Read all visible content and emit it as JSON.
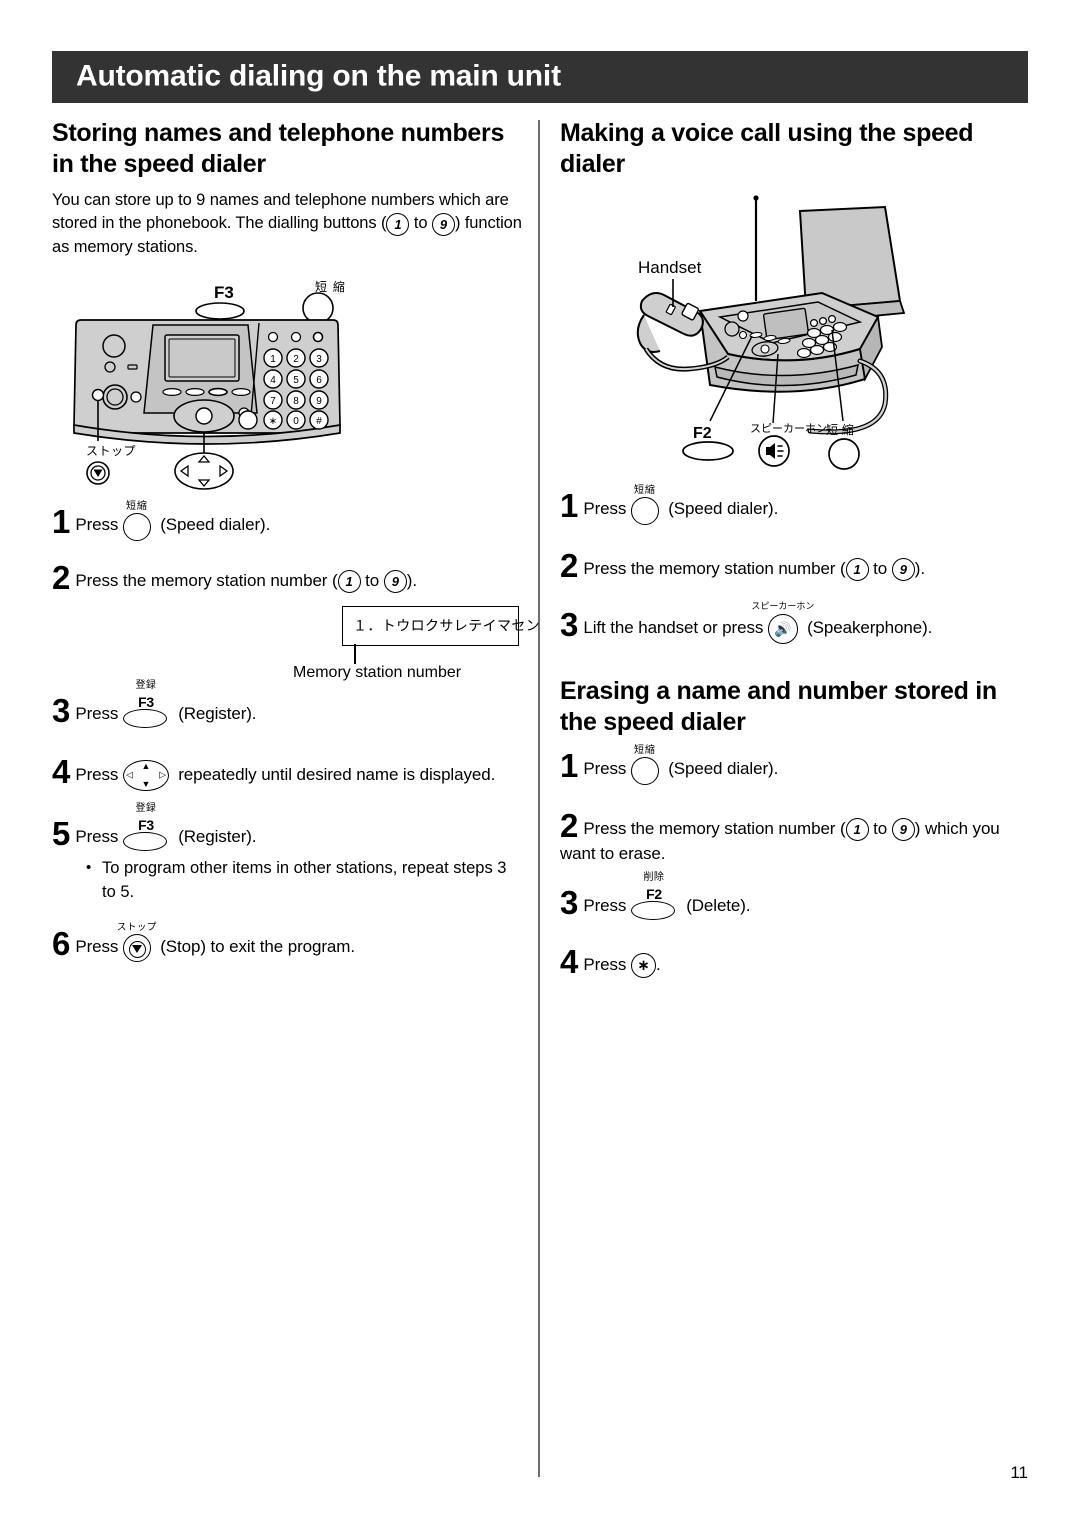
{
  "header": {
    "title": "Automatic dialing on the main unit"
  },
  "left": {
    "section_title": "Storing names and telephone numbers in the speed dialer",
    "intro_part1": "You can store up to 9 names and telephone numbers which are stored in the phonebook. The dialling buttons (",
    "intro_digit_from": "1",
    "intro_mid": " to ",
    "intro_digit_to": "9",
    "intro_part2": ") function as memory stations.",
    "figure": {
      "label_f3": "F3",
      "label_speed_jp": "短縮",
      "label_stop_jp": "ストップ",
      "keypad": [
        "1",
        "2",
        "3",
        "4",
        "5",
        "6",
        "7",
        "8",
        "9",
        "∗",
        "0",
        "#"
      ]
    },
    "steps": [
      {
        "num": "1",
        "pre": "Press ",
        "key": "speed-dialer-round",
        "key_jp": "短縮",
        "post": "(Speed dialer)."
      },
      {
        "num": "2",
        "pre": "Press the memory station number (",
        "digit_from": "1",
        "mid": " to ",
        "digit_to": "9",
        "post": ")."
      },
      {
        "num": "3",
        "pre": "Press ",
        "key": "f3-oval",
        "key_label": "F3",
        "key_jp": "登録",
        "post": "(Register)."
      },
      {
        "num": "4",
        "pre": "Press ",
        "key": "navigation-pad",
        "post": "repeatedly until desired name is displayed."
      },
      {
        "num": "5",
        "pre": "Press ",
        "key": "f3-oval",
        "key_label": "F3",
        "key_jp": "登録",
        "post": "(Register).",
        "sub": "To program other items in other stations, repeat steps 3 to 5."
      },
      {
        "num": "6",
        "pre": "Press ",
        "key": "stop-button",
        "key_jp": "ストップ",
        "post": "(Stop) to exit the program."
      }
    ],
    "lcd": {
      "display_text": "１．トウロクサレテイマセン",
      "caption": "Memory station number"
    }
  },
  "right": {
    "section1_title": "Making a voice call using the speed dialer",
    "figure": {
      "label_handset": "Handset",
      "label_f2": "F2",
      "label_speakerphone_jp": "スピーカーホン",
      "label_speed_jp": "短 縮"
    },
    "steps1": [
      {
        "num": "1",
        "pre": "Press ",
        "key": "speed-dialer-round",
        "key_jp": "短縮",
        "post": "(Speed dialer)."
      },
      {
        "num": "2",
        "pre": "Press the memory station number (",
        "digit_from": "1",
        "mid": " to ",
        "digit_to": "9",
        "post": ")."
      },
      {
        "num": "3",
        "pre": "Lift the handset or press ",
        "key": "speakerphone-button",
        "key_jp": "スピーカーホン",
        "post": "(Speakerphone)."
      }
    ],
    "section2_title": "Erasing a name and number stored in the speed dialer",
    "steps2": [
      {
        "num": "1",
        "pre": "Press ",
        "key": "speed-dialer-round",
        "key_jp": "短縮",
        "post": "(Speed dialer)."
      },
      {
        "num": "2",
        "pre": "Press the memory station number (",
        "digit_from": "1",
        "mid": " to ",
        "digit_to": "9",
        "post": ") which you want to erase."
      },
      {
        "num": "3",
        "pre": "Press ",
        "key": "f2-oval",
        "key_label": "F2",
        "key_jp": "削除",
        "post": "(Delete)."
      },
      {
        "num": "4",
        "pre": "Press ",
        "key": "asterisk-key",
        "key_label": "∗",
        "post": "."
      }
    ]
  },
  "footer": {
    "page_number": "11"
  },
  "colors": {
    "banner_bg": "#333333",
    "text": "#000000",
    "divider": "#6d6d6d",
    "panel_fill": "#cfcfcf",
    "panel_dark": "#a8a8a8"
  }
}
